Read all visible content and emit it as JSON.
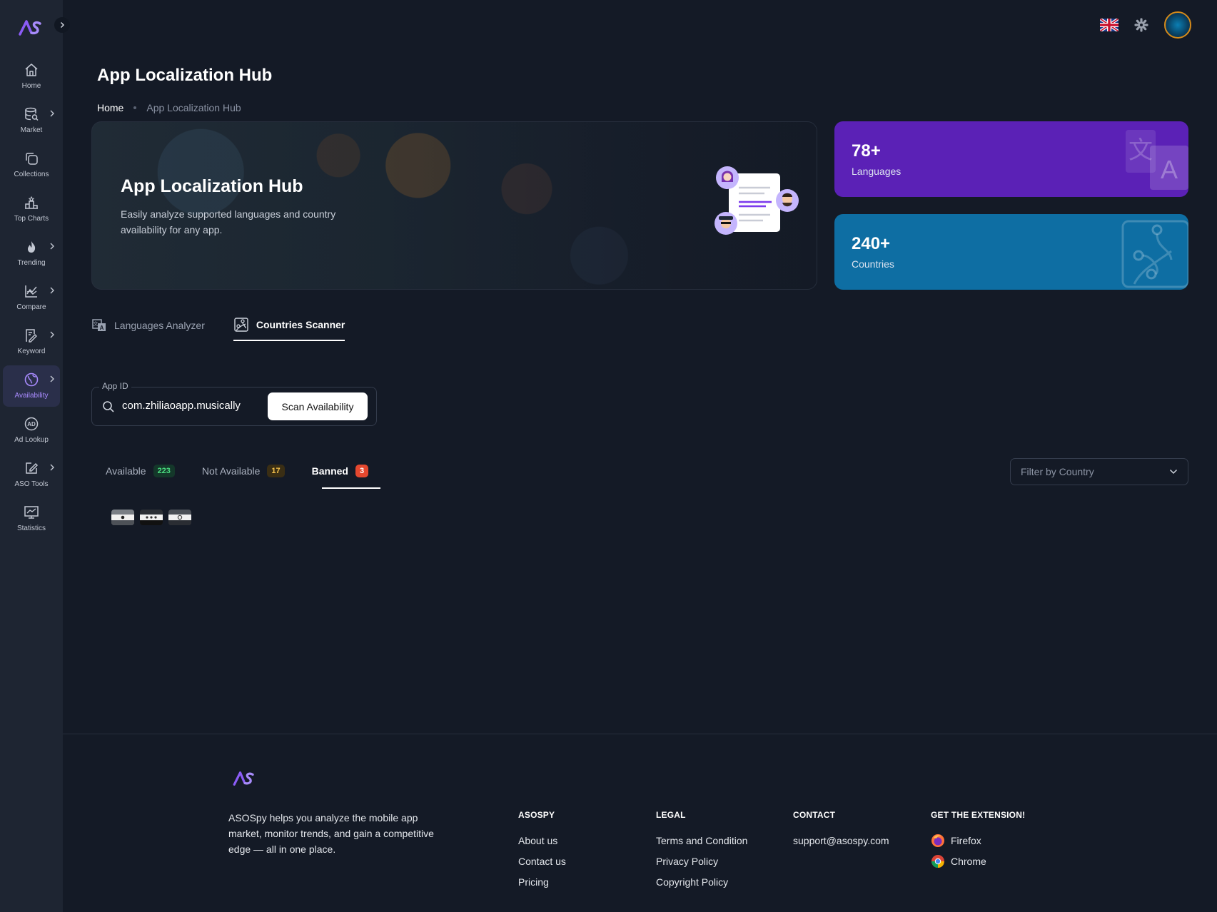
{
  "sidebar": {
    "items": [
      {
        "label": "Home",
        "icon": "home-icon",
        "chevron": false,
        "active": false
      },
      {
        "label": "Market",
        "icon": "database-search-icon",
        "chevron": true,
        "active": false
      },
      {
        "label": "Collections",
        "icon": "collections-icon",
        "chevron": false,
        "active": false
      },
      {
        "label": "Top Charts",
        "icon": "podium-icon",
        "chevron": false,
        "active": false
      },
      {
        "label": "Trending",
        "icon": "flame-icon",
        "chevron": true,
        "active": false
      },
      {
        "label": "Compare",
        "icon": "line-chart-icon",
        "chevron": true,
        "active": false
      },
      {
        "label": "Keyword",
        "icon": "keyword-icon",
        "chevron": true,
        "active": false
      },
      {
        "label": "Availability",
        "icon": "globe-icon",
        "chevron": true,
        "active": true
      },
      {
        "label": "Ad Lookup",
        "icon": "ad-icon",
        "chevron": false,
        "active": false
      },
      {
        "label": "ASO Tools",
        "icon": "edit-icon",
        "chevron": true,
        "active": false
      },
      {
        "label": "Statistics",
        "icon": "statistics-icon",
        "chevron": false,
        "active": false
      }
    ]
  },
  "header": {
    "title": "App Localization Hub"
  },
  "breadcrumb": {
    "home": "Home",
    "current": "App Localization Hub"
  },
  "hero": {
    "title": "App Localization Hub",
    "subtitle": "Easily analyze supported languages and country availability for any app."
  },
  "stats": {
    "languages": {
      "value": "78+",
      "label": "Languages"
    },
    "countries": {
      "value": "240+",
      "label": "Countries"
    }
  },
  "tabs": [
    {
      "label": "Languages Analyzer",
      "active": false
    },
    {
      "label": "Countries Scanner",
      "active": true
    }
  ],
  "app_id": {
    "label": "App ID",
    "value": "com.zhiliaoapp.musically",
    "button": "Scan Availability"
  },
  "results": {
    "tabs": [
      {
        "label": "Available",
        "count": "223"
      },
      {
        "label": "Not Available",
        "count": "17"
      },
      {
        "label": "Banned",
        "count": "3"
      }
    ],
    "filter_placeholder": "Filter by Country"
  },
  "footer": {
    "description": "ASOSpy helps you analyze the mobile app market, monitor trends, and gain a competitive edge — all in one place.",
    "asospy": {
      "heading": "ASOSPY",
      "links": [
        "About us",
        "Contact us",
        "Pricing"
      ]
    },
    "legal": {
      "heading": "LEGAL",
      "links": [
        "Terms and Condition",
        "Privacy Policy",
        "Copyright Policy"
      ]
    },
    "contact": {
      "heading": "CONTACT",
      "email": "support@asospy.com"
    },
    "extension": {
      "heading": "GET THE EXTENSION!",
      "links": [
        "Firefox",
        "Chrome"
      ]
    }
  },
  "colors": {
    "accent": "#a98bff",
    "languages_card": "#5b21b6",
    "countries_card": "#0e6ea3",
    "banned": "#e5482f"
  }
}
